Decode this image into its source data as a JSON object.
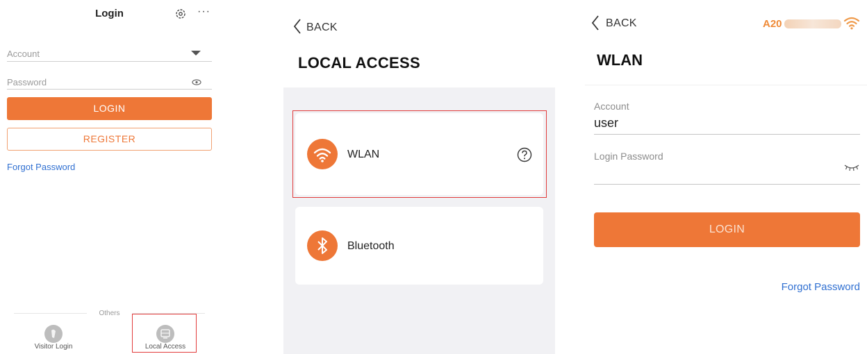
{
  "login_screen": {
    "title": "Login",
    "more_label": "···",
    "account_placeholder": "Account",
    "password_placeholder": "Password",
    "login_button": "LOGIN",
    "register_button": "REGISTER",
    "forgot_password": "Forgot Password",
    "others_label": "Others",
    "visitor_login": "Visitor Login",
    "local_access": "Local Access",
    "icons": [
      "gear-icon",
      "more-icon",
      "dropdown-icon",
      "eye-icon",
      "visitor-icon",
      "local-access-icon"
    ]
  },
  "local_access_screen": {
    "back_label": "BACK",
    "title": "LOCAL ACCESS",
    "options": [
      {
        "label": "WLAN",
        "icon": "wifi-icon",
        "help_icon": "help-icon"
      },
      {
        "label": "Bluetooth",
        "icon": "bluetooth-icon"
      }
    ]
  },
  "wlan_screen": {
    "back_label": "BACK",
    "device_prefix": "A20",
    "title": "WLAN",
    "account_label": "Account",
    "account_value": "user",
    "password_label": "Login Password",
    "login_button": "LOGIN",
    "forgot_password": "Forgot Password"
  },
  "colors": {
    "accent": "#ee7737",
    "link": "#2f6fd1",
    "highlight": "#e23b3b",
    "device_name": "#ef8a37"
  }
}
